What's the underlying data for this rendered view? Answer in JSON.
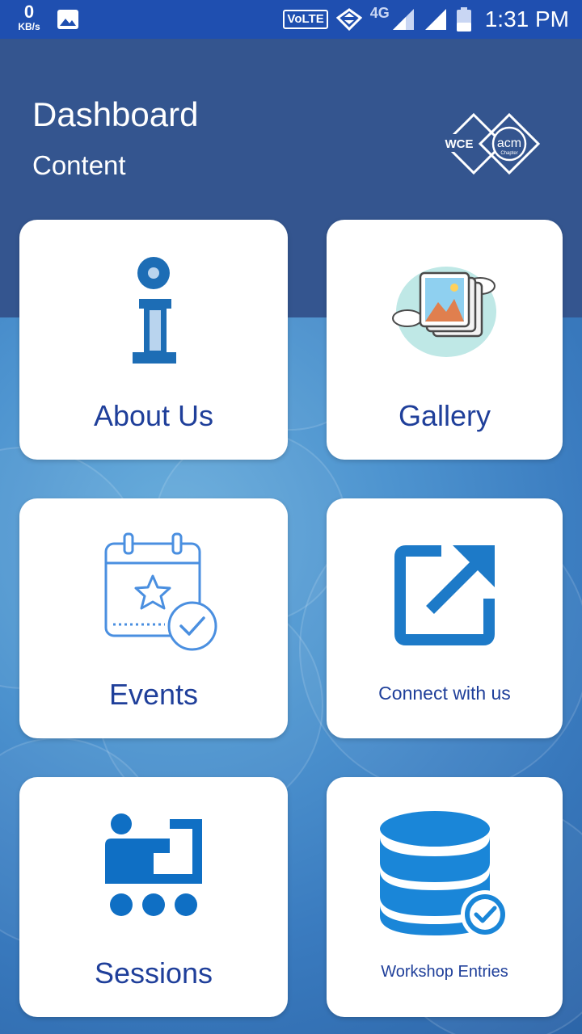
{
  "status_bar": {
    "speed_value": "0",
    "speed_unit": "KB/s",
    "volte": "VoLTE",
    "network": "4G",
    "time": "1:31 PM"
  },
  "header": {
    "title": "Dashboard",
    "subtitle": "Content",
    "logo_left": "WCE",
    "logo_circle": "acm",
    "logo_small": "Chapter"
  },
  "cards": [
    {
      "label": "About Us",
      "icon": "info-icon"
    },
    {
      "label": "Gallery",
      "icon": "gallery-icon"
    },
    {
      "label": "Events",
      "icon": "calendar-event-icon"
    },
    {
      "label": "Connect with us",
      "icon": "external-link-icon"
    },
    {
      "label": "Sessions",
      "icon": "presentation-icon"
    },
    {
      "label": "Workshop Entries",
      "icon": "database-check-icon"
    }
  ],
  "colors": {
    "status_bar": "#1f4fb0",
    "header": "#34558f",
    "card_text": "#1f3f9a",
    "icon_blue": "#0f6fc4"
  }
}
